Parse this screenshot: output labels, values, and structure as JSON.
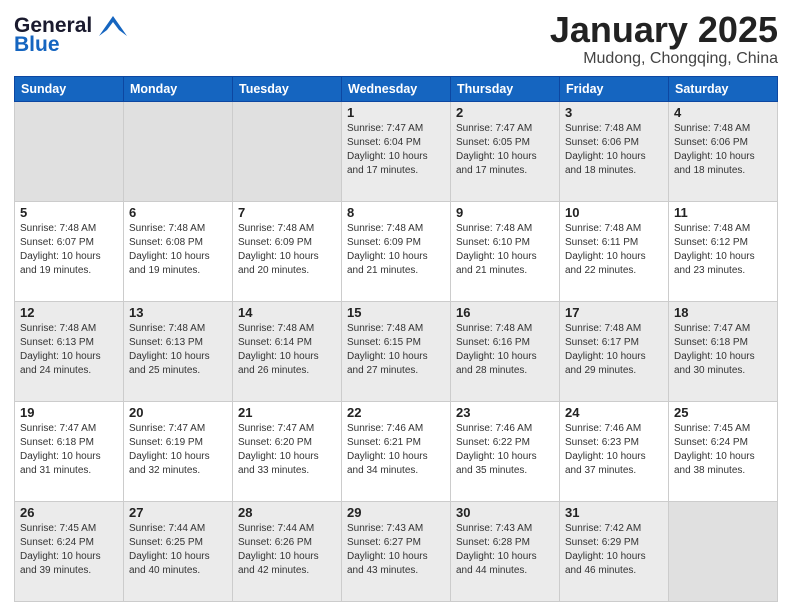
{
  "header": {
    "logo_general": "General",
    "logo_blue": "Blue",
    "month_title": "January 2025",
    "location": "Mudong, Chongqing, China"
  },
  "weekdays": [
    "Sunday",
    "Monday",
    "Tuesday",
    "Wednesday",
    "Thursday",
    "Friday",
    "Saturday"
  ],
  "weeks": [
    [
      {
        "day": "",
        "info": "",
        "empty": true
      },
      {
        "day": "",
        "info": "",
        "empty": true
      },
      {
        "day": "",
        "info": "",
        "empty": true
      },
      {
        "day": "1",
        "info": "Sunrise: 7:47 AM\nSunset: 6:04 PM\nDaylight: 10 hours\nand 17 minutes."
      },
      {
        "day": "2",
        "info": "Sunrise: 7:47 AM\nSunset: 6:05 PM\nDaylight: 10 hours\nand 17 minutes."
      },
      {
        "day": "3",
        "info": "Sunrise: 7:48 AM\nSunset: 6:06 PM\nDaylight: 10 hours\nand 18 minutes."
      },
      {
        "day": "4",
        "info": "Sunrise: 7:48 AM\nSunset: 6:06 PM\nDaylight: 10 hours\nand 18 minutes."
      }
    ],
    [
      {
        "day": "5",
        "info": "Sunrise: 7:48 AM\nSunset: 6:07 PM\nDaylight: 10 hours\nand 19 minutes."
      },
      {
        "day": "6",
        "info": "Sunrise: 7:48 AM\nSunset: 6:08 PM\nDaylight: 10 hours\nand 19 minutes."
      },
      {
        "day": "7",
        "info": "Sunrise: 7:48 AM\nSunset: 6:09 PM\nDaylight: 10 hours\nand 20 minutes."
      },
      {
        "day": "8",
        "info": "Sunrise: 7:48 AM\nSunset: 6:09 PM\nDaylight: 10 hours\nand 21 minutes."
      },
      {
        "day": "9",
        "info": "Sunrise: 7:48 AM\nSunset: 6:10 PM\nDaylight: 10 hours\nand 21 minutes."
      },
      {
        "day": "10",
        "info": "Sunrise: 7:48 AM\nSunset: 6:11 PM\nDaylight: 10 hours\nand 22 minutes."
      },
      {
        "day": "11",
        "info": "Sunrise: 7:48 AM\nSunset: 6:12 PM\nDaylight: 10 hours\nand 23 minutes."
      }
    ],
    [
      {
        "day": "12",
        "info": "Sunrise: 7:48 AM\nSunset: 6:13 PM\nDaylight: 10 hours\nand 24 minutes."
      },
      {
        "day": "13",
        "info": "Sunrise: 7:48 AM\nSunset: 6:13 PM\nDaylight: 10 hours\nand 25 minutes."
      },
      {
        "day": "14",
        "info": "Sunrise: 7:48 AM\nSunset: 6:14 PM\nDaylight: 10 hours\nand 26 minutes."
      },
      {
        "day": "15",
        "info": "Sunrise: 7:48 AM\nSunset: 6:15 PM\nDaylight: 10 hours\nand 27 minutes."
      },
      {
        "day": "16",
        "info": "Sunrise: 7:48 AM\nSunset: 6:16 PM\nDaylight: 10 hours\nand 28 minutes."
      },
      {
        "day": "17",
        "info": "Sunrise: 7:48 AM\nSunset: 6:17 PM\nDaylight: 10 hours\nand 29 minutes."
      },
      {
        "day": "18",
        "info": "Sunrise: 7:47 AM\nSunset: 6:18 PM\nDaylight: 10 hours\nand 30 minutes."
      }
    ],
    [
      {
        "day": "19",
        "info": "Sunrise: 7:47 AM\nSunset: 6:18 PM\nDaylight: 10 hours\nand 31 minutes."
      },
      {
        "day": "20",
        "info": "Sunrise: 7:47 AM\nSunset: 6:19 PM\nDaylight: 10 hours\nand 32 minutes."
      },
      {
        "day": "21",
        "info": "Sunrise: 7:47 AM\nSunset: 6:20 PM\nDaylight: 10 hours\nand 33 minutes."
      },
      {
        "day": "22",
        "info": "Sunrise: 7:46 AM\nSunset: 6:21 PM\nDaylight: 10 hours\nand 34 minutes."
      },
      {
        "day": "23",
        "info": "Sunrise: 7:46 AM\nSunset: 6:22 PM\nDaylight: 10 hours\nand 35 minutes."
      },
      {
        "day": "24",
        "info": "Sunrise: 7:46 AM\nSunset: 6:23 PM\nDaylight: 10 hours\nand 37 minutes."
      },
      {
        "day": "25",
        "info": "Sunrise: 7:45 AM\nSunset: 6:24 PM\nDaylight: 10 hours\nand 38 minutes."
      }
    ],
    [
      {
        "day": "26",
        "info": "Sunrise: 7:45 AM\nSunset: 6:24 PM\nDaylight: 10 hours\nand 39 minutes."
      },
      {
        "day": "27",
        "info": "Sunrise: 7:44 AM\nSunset: 6:25 PM\nDaylight: 10 hours\nand 40 minutes."
      },
      {
        "day": "28",
        "info": "Sunrise: 7:44 AM\nSunset: 6:26 PM\nDaylight: 10 hours\nand 42 minutes."
      },
      {
        "day": "29",
        "info": "Sunrise: 7:43 AM\nSunset: 6:27 PM\nDaylight: 10 hours\nand 43 minutes."
      },
      {
        "day": "30",
        "info": "Sunrise: 7:43 AM\nSunset: 6:28 PM\nDaylight: 10 hours\nand 44 minutes."
      },
      {
        "day": "31",
        "info": "Sunrise: 7:42 AM\nSunset: 6:29 PM\nDaylight: 10 hours\nand 46 minutes."
      },
      {
        "day": "",
        "info": "",
        "empty": true
      }
    ]
  ]
}
